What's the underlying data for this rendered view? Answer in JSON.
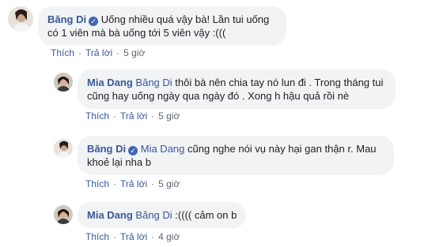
{
  "comments": [
    {
      "author": "Băng Di",
      "verified": true,
      "mention": "",
      "text": "Uống nhiều quá vậy bà! Lần tui uống có 1 viên mà bà uống tới 5 viên vậy :(((",
      "like": "Thích",
      "reply": "Trả lời",
      "time": "5 giờ"
    },
    {
      "author": "Mia Dang",
      "verified": false,
      "mention": "Băng Di",
      "text": "thôi bà nên chia tay nó lun đi . Trong tháng tui cũng hay uống ngày qua ngày đó . Xong h hậu quả rồi nè",
      "like": "Thích",
      "reply": "Trả lời",
      "time": "5 giờ"
    },
    {
      "author": "Băng Di",
      "verified": true,
      "mention": "Mia Dang",
      "text": "cũng nghe nói vụ này hại gan thận r. Mau khoẻ lại nha b",
      "like": "Thích",
      "reply": "Trả lời",
      "time": "5 giờ"
    },
    {
      "author": "Mia Dang",
      "verified": false,
      "mention": "Băng Di",
      "text": ":(((( cảm on b",
      "like": "Thích",
      "reply": "Trả lời",
      "time": "4 giờ"
    }
  ],
  "separator": "·",
  "verified_icon": "check-icon"
}
